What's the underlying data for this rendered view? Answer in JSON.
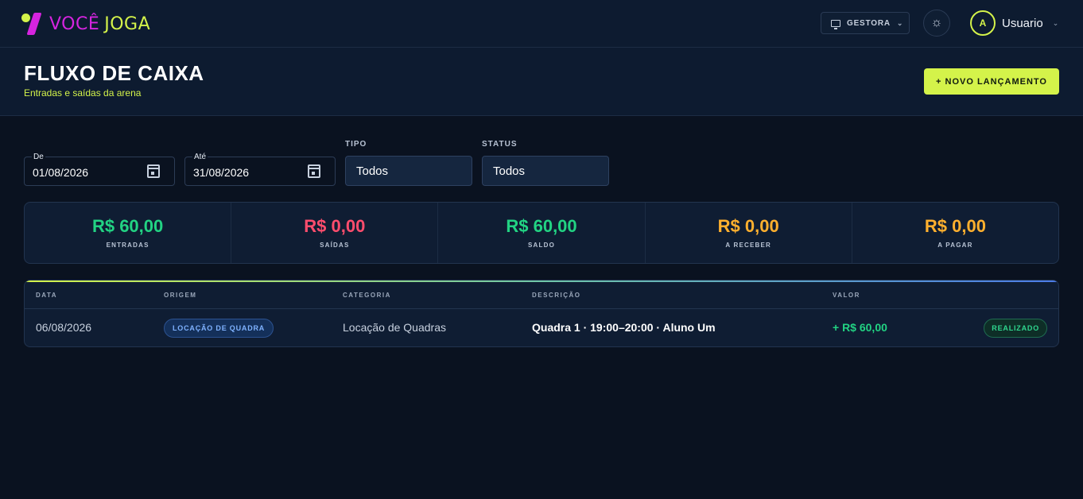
{
  "app": {
    "brand_word1": "VOCÊ",
    "brand_word2": "JOGA"
  },
  "topbar": {
    "role_label": "GESTORA",
    "theme_icon": "sun-icon",
    "user_initial": "A",
    "user_name": "Usuario"
  },
  "header": {
    "title": "FLUXO DE CAIXA",
    "subtitle": "Entradas e saídas da arena",
    "new_button": "+ NOVO LANÇAMENTO"
  },
  "filters": {
    "date_from": {
      "label": "De",
      "value": "01/08/2026"
    },
    "date_to": {
      "label": "Até",
      "value": "31/08/2026"
    },
    "tipo": {
      "label": "TIPO",
      "value": "Todos"
    },
    "status": {
      "label": "STATUS",
      "value": "Todos"
    }
  },
  "summary": [
    {
      "value": "R$ 60,00",
      "label": "ENTRADAS",
      "color": "#22d383"
    },
    {
      "value": "R$ 0,00",
      "label": "SAÍDAS",
      "color": "#ff4d6d"
    },
    {
      "value": "R$ 60,00",
      "label": "SALDO",
      "color": "#22d383"
    },
    {
      "value": "R$ 0,00",
      "label": "A RECEBER",
      "color": "#ffb02e"
    },
    {
      "value": "R$ 0,00",
      "label": "A PAGAR",
      "color": "#ffb02e"
    }
  ],
  "table": {
    "columns": [
      "DATA",
      "ORIGEM",
      "CATEGORIA",
      "DESCRIÇÃO",
      "VALOR"
    ],
    "rows": [
      {
        "data": "06/08/2026",
        "origem": "LOCAÇÃO DE QUADRA",
        "categoria": "Locação de Quadras",
        "descricao": "Quadra 1 · 19:00–20:00 · Aluno Um",
        "valor": "+ R$ 60,00",
        "status": "REALIZADO"
      }
    ]
  },
  "colors": {
    "accent": "#d4f34a",
    "brand_magenta": "#d624e0",
    "background": "#0a1220"
  }
}
